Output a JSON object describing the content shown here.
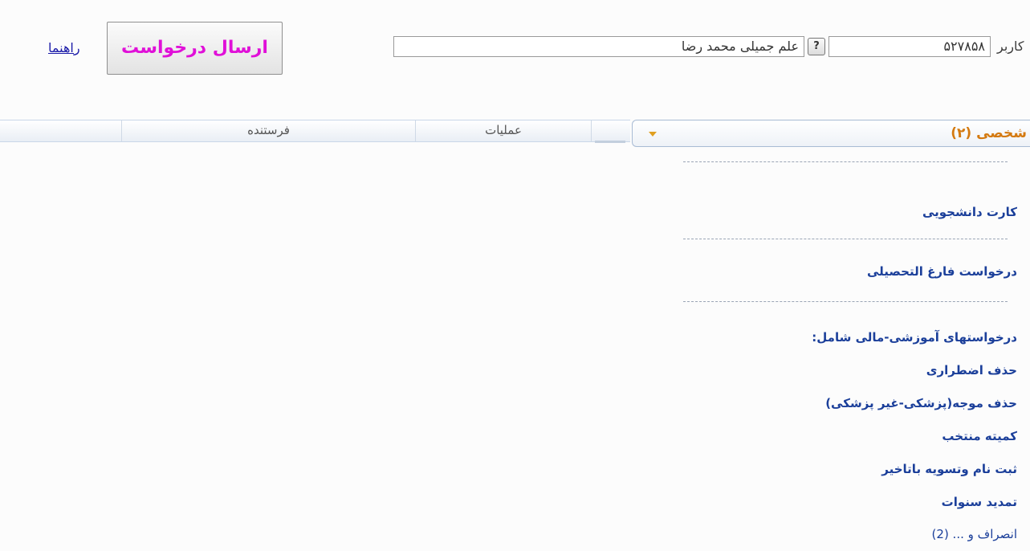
{
  "header": {
    "user_label": "کاربر",
    "user_code": "۵۲۷۸۵۸",
    "help_icon": "?",
    "user_name": "علم جمیلی محمد رضا",
    "send_request": "ارسال درخواست",
    "guide_link": "راهنما"
  },
  "grid": {
    "columns": [
      "",
      "فرستنده",
      "عملیات",
      ""
    ]
  },
  "panel": {
    "dropdown_title": "شخصی (۲)",
    "items": [
      "کارت دانشجویی",
      "درخواست فارغ التحصیلی",
      "درخواستهای آموزشی-مالی شامل:",
      "حذف اضطراری",
      "حذف موجه(پزشکی-غیر پزشکی)",
      "کمیته منتخب",
      "ثبت نام وتسویه باتاخیر",
      "تمدید سنوات",
      "انصراف و ... (2)"
    ]
  }
}
